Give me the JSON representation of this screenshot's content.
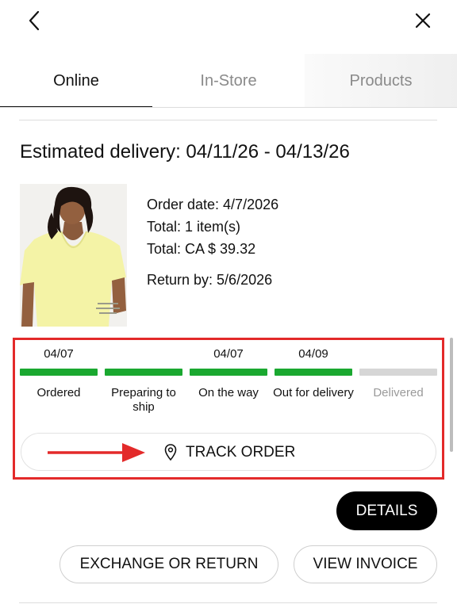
{
  "header": {
    "back_icon": "chevron-left-icon",
    "close_icon": "close-icon"
  },
  "tabs": [
    {
      "label": "Online",
      "active": true
    },
    {
      "label": "In-Store",
      "active": false
    },
    {
      "label": "Products",
      "active": false
    }
  ],
  "order": {
    "estimated_delivery": "Estimated delivery: 04/11/26 - 04/13/26",
    "order_date": "Order date: 4/7/2026",
    "total_items": "Total: 1 item(s)",
    "total_price": "Total: CA $ 39.32",
    "return_by": "Return by: 5/6/2026",
    "image_caption": "Light yellow v-neck t-shirt product photo"
  },
  "tracking": {
    "steps": [
      {
        "date": "04/07",
        "label": "Ordered",
        "complete": true
      },
      {
        "date": "",
        "label": "Preparing to ship",
        "complete": true
      },
      {
        "date": "04/07",
        "label": "On the way",
        "complete": true
      },
      {
        "date": "04/09",
        "label": "Out for delivery",
        "complete": true
      },
      {
        "date": "",
        "label": "Delivered",
        "complete": false
      }
    ],
    "track_label": "TRACK ORDER",
    "pin_icon": "location-pin-icon",
    "complete_color": "#1aa830",
    "pending_color": "#d6d6d6",
    "annotation_color": "#e32a2a"
  },
  "actions": {
    "details_label": "DETAILS",
    "exchange_label": "EXCHANGE OR RETURN",
    "invoice_label": "VIEW INVOICE"
  }
}
